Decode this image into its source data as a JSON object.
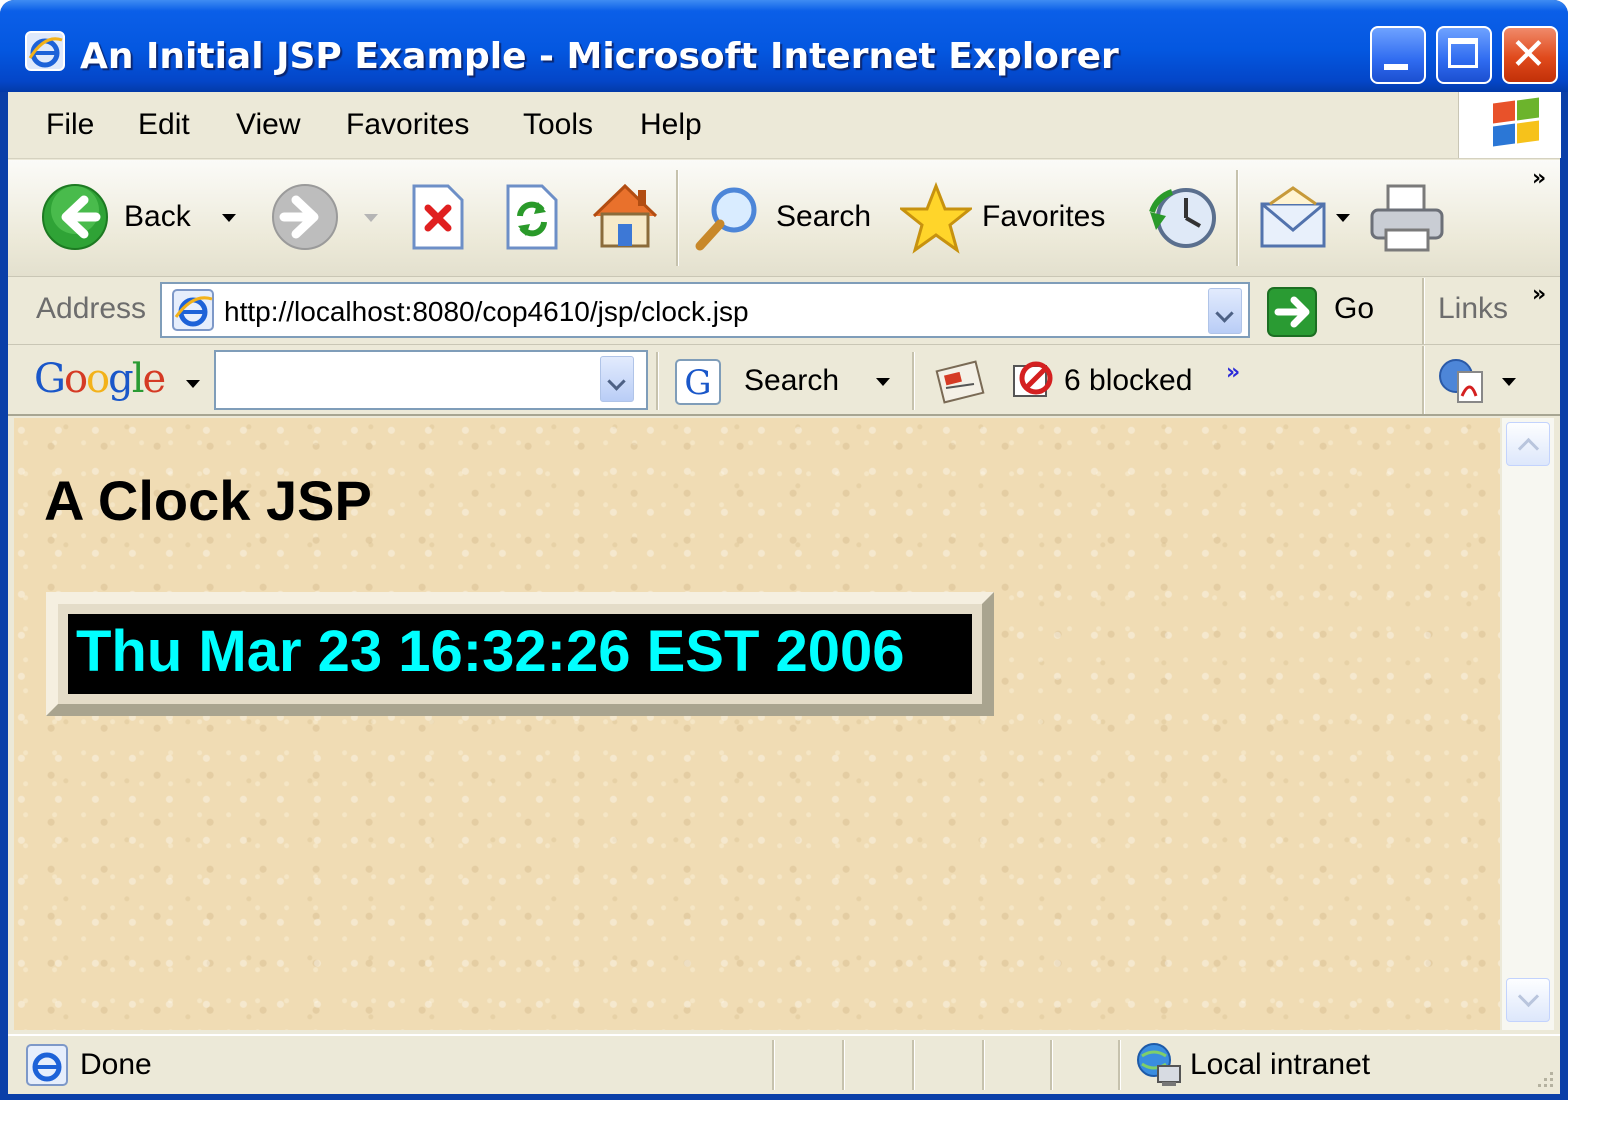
{
  "window": {
    "title": "An Initial JSP Example - Microsoft Internet Explorer"
  },
  "menu": {
    "items": [
      "File",
      "Edit",
      "View",
      "Favorites",
      "Tools",
      "Help"
    ]
  },
  "toolbar": {
    "back_label": "Back",
    "search_label": "Search",
    "favorites_label": "Favorites",
    "overflow": "»"
  },
  "address_bar": {
    "label": "Address",
    "url": "http://localhost:8080/cop4610/jsp/clock.jsp",
    "go_label": "Go",
    "links_label": "Links",
    "overflow": "»"
  },
  "google_bar": {
    "search_label": "Search",
    "blocked_label": "6 blocked",
    "overflow": "»",
    "query": ""
  },
  "page": {
    "heading": "A Clock JSP",
    "clock": "Thu Mar 23 16:32:26 EST 2006"
  },
  "status": {
    "text": "Done",
    "zone": "Local intranet"
  },
  "colors": {
    "titlebar": "#0457e0",
    "chrome": "#ece9d8",
    "page_background": "#f0dcb4",
    "clock_text": "#00ffff",
    "clock_background": "#000000"
  }
}
